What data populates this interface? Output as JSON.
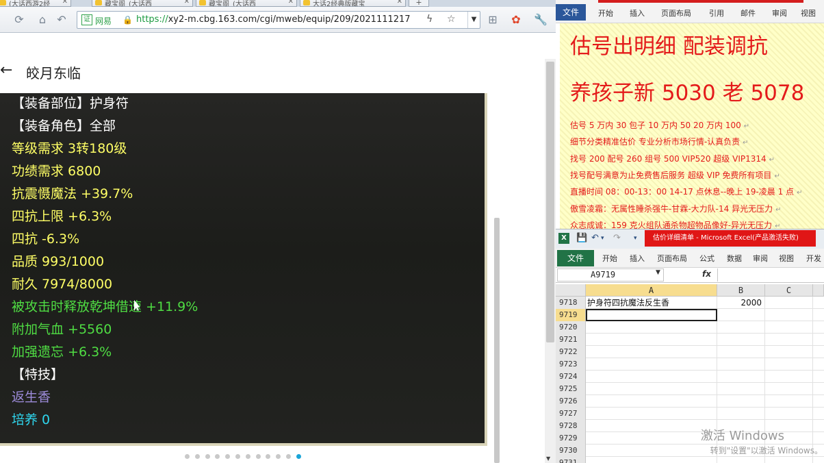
{
  "browser": {
    "tabs": [
      {
        "label": "(大话西游2经"
      },
      {
        "label": "藏宝阁_(大话西"
      },
      {
        "label": "藏宝阁_(大话西"
      },
      {
        "label": "大话2经典版藏宝"
      }
    ],
    "new_tab_label": "+",
    "cert_label": "网易",
    "url_scheme": "https://",
    "url_rest": "xy2-m.cbg.163.com/cgi/mweb/equip/209/2021111217",
    "page_title": "皎月东临",
    "detail_lines": [
      {
        "text": "【装备部位】护身符",
        "color": "white"
      },
      {
        "text": "【装备角色】全部",
        "color": "white"
      },
      {
        "text": "等级需求 3转180级",
        "color": "yellow"
      },
      {
        "text": "功绩需求 6800",
        "color": "yellow"
      },
      {
        "text": "抗震慑魔法 +39.7%",
        "color": "yellow"
      },
      {
        "text": "四抗上限 +6.3%",
        "color": "yellow"
      },
      {
        "text": "四抗 -6.3%",
        "color": "yellow"
      },
      {
        "text": "品质 993/1000",
        "color": "yellow"
      },
      {
        "text": "耐久 7974/8000",
        "color": "yellow"
      },
      {
        "text": "被攻击时释放乾坤借速 +11.9%",
        "color": "green"
      },
      {
        "text": "附加气血 +5560",
        "color": "green"
      },
      {
        "text": "加强遗忘 +6.3%",
        "color": "green"
      },
      {
        "text": "【特技】",
        "color": "white"
      },
      {
        "text": "返生香",
        "color": "purple"
      },
      {
        "text": "培养 0",
        "color": "cyan"
      }
    ],
    "pager": {
      "count": 12,
      "active_index": 11
    }
  },
  "word": {
    "file_label": "文件",
    "tabs": [
      "开始",
      "插入",
      "页面布局",
      "引用",
      "邮件",
      "审阅",
      "视图"
    ],
    "heading1": "估号出明细 配装调抗",
    "heading2": "养孩子新 5030 老 5078",
    "lines": [
      "估号 5 万内 30 包子  10 万内 50  20 万内 100",
      "细节分类精准估价  专业分析市场行情-认真负责",
      "找号 200   配号 260   组号 500 VIP520   超级 VIP1314",
      "找号配号满意为止免费售后服务   超级 VIP 免费所有项目",
      "直播时间 08：00-13：00 14-17 点休息--晚上 19-凌晨 1 点",
      "傲雪凌霜：无属性睡杀强牛-甘霖-大力队-14 异光无压力",
      "众志成诚：159 克火组队通杀物超物品像好-异光无压力"
    ]
  },
  "excel": {
    "logo": "X",
    "title": "估价详细清单 - Microsoft Excel(产品激活失败)",
    "file_label": "文件",
    "tabs": [
      "开始",
      "插入",
      "页面布局",
      "公式",
      "数据",
      "审阅",
      "视图",
      "开发"
    ],
    "name_box": "A9719",
    "fx_label": "fx",
    "columns": [
      "A",
      "B",
      "C"
    ],
    "rows": [
      {
        "num": "9718",
        "a": "护身符四抗魔法反生香",
        "b": "2000"
      },
      {
        "num": "9719",
        "a": "",
        "b": ""
      },
      {
        "num": "9720",
        "a": "",
        "b": ""
      },
      {
        "num": "9721",
        "a": "",
        "b": ""
      },
      {
        "num": "9722",
        "a": "",
        "b": ""
      },
      {
        "num": "9723",
        "a": "",
        "b": ""
      },
      {
        "num": "9724",
        "a": "",
        "b": ""
      },
      {
        "num": "9725",
        "a": "",
        "b": ""
      },
      {
        "num": "9726",
        "a": "",
        "b": ""
      },
      {
        "num": "9727",
        "a": "",
        "b": ""
      },
      {
        "num": "9728",
        "a": "",
        "b": ""
      },
      {
        "num": "9729",
        "a": "",
        "b": ""
      },
      {
        "num": "9730",
        "a": "",
        "b": ""
      },
      {
        "num": "9731",
        "a": "",
        "b": ""
      }
    ],
    "active_row": "9719"
  },
  "watermark": {
    "line1": "激活 Windows",
    "line2": "转到\"设置\"以激活 Windows。"
  },
  "colors": {
    "detail_bg": "#1f201d",
    "yellow_text": "#ffff66",
    "green_text": "#4fdd43",
    "purple_text": "#9c8bd9",
    "cyan_text": "#2fd6ee",
    "word_red": "#e41b1b",
    "excel_green": "#217346"
  }
}
